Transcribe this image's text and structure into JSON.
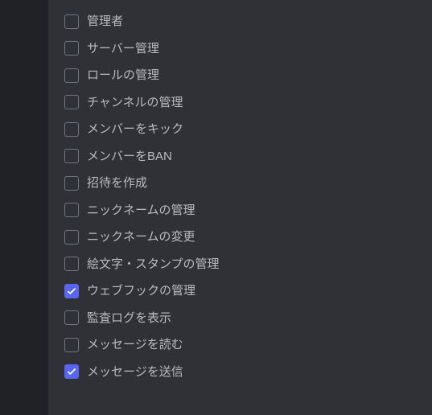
{
  "permissions": [
    {
      "label": "管理者",
      "checked": false
    },
    {
      "label": "サーバー管理",
      "checked": false
    },
    {
      "label": "ロールの管理",
      "checked": false
    },
    {
      "label": "チャンネルの管理",
      "checked": false
    },
    {
      "label": "メンバーをキック",
      "checked": false
    },
    {
      "label": "メンバーをBAN",
      "checked": false
    },
    {
      "label": "招待を作成",
      "checked": false
    },
    {
      "label": "ニックネームの管理",
      "checked": false
    },
    {
      "label": "ニックネームの変更",
      "checked": false
    },
    {
      "label": "絵文字・スタンプの管理",
      "checked": false
    },
    {
      "label": "ウェブフックの管理",
      "checked": true
    },
    {
      "label": "監査ログを表示",
      "checked": false
    },
    {
      "label": "メッセージを読む",
      "checked": false
    },
    {
      "label": "メッセージを送信",
      "checked": true
    }
  ]
}
